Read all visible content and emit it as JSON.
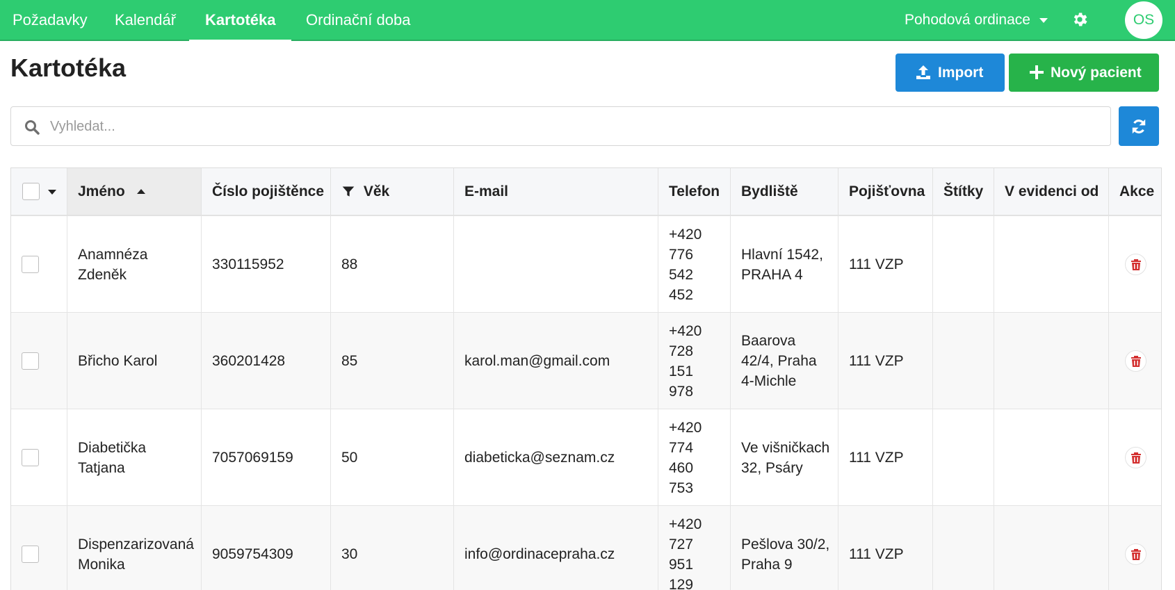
{
  "nav": {
    "items": [
      {
        "label": "Požadavky"
      },
      {
        "label": "Kalendář"
      },
      {
        "label": "Kartotéka"
      },
      {
        "label": "Ordinační doba"
      }
    ],
    "practice": "Pohodová ordinace",
    "avatar": "OS"
  },
  "header": {
    "title": "Kartotéka",
    "import_label": "Import",
    "new_label": "Nový pacient"
  },
  "search": {
    "placeholder": "Vyhledat..."
  },
  "table": {
    "columns": [
      "Jméno",
      "Číslo pojištěnce",
      "Věk",
      "E-mail",
      "Telefon",
      "Bydliště",
      "Pojišťovna",
      "Štítky",
      "V evidenci od",
      "Akce"
    ],
    "rows": [
      {
        "name": [
          "Anamnéza",
          "Zdeněk"
        ],
        "insurance_no": "330115952",
        "age": "88",
        "email": "",
        "phone": [
          "+420",
          "776",
          "542",
          "452"
        ],
        "address": [
          "Hlavní 1542,",
          "PRAHA 4"
        ],
        "insurer": "111 VZP",
        "tags": "",
        "since": ""
      },
      {
        "name": [
          "Břicho Karol"
        ],
        "insurance_no": "360201428",
        "age": "85",
        "email": "karol.man@gmail.com",
        "phone": [
          "+420",
          "728",
          "151",
          "978"
        ],
        "address": [
          "Baarova",
          "42/4, Praha",
          "4-Michle"
        ],
        "insurer": "111 VZP",
        "tags": "",
        "since": ""
      },
      {
        "name": [
          "Diabetička",
          "Tatjana"
        ],
        "insurance_no": "7057069159",
        "age": "50",
        "email": "diabeticka@seznam.cz",
        "phone": [
          "+420",
          "774",
          "460",
          "753"
        ],
        "address": [
          "Ve višničkach",
          "32, Psáry"
        ],
        "insurer": "111 VZP",
        "tags": "",
        "since": ""
      },
      {
        "name": [
          "Dispenzarizovaná",
          "Monika"
        ],
        "insurance_no": "9059754309",
        "age": "30",
        "email": "info@ordinacepraha.cz",
        "phone": [
          "+420",
          "727",
          "951",
          "129"
        ],
        "address": [
          "Pešlova 30/2,",
          "Praha 9"
        ],
        "insurer": "111 VZP",
        "tags": "",
        "since": ""
      }
    ]
  },
  "colors": {
    "nav_bg": "#2ecc71",
    "import_btn": "#1e88d8",
    "new_btn": "#27b34a",
    "delete_icon": "#d32f2f"
  },
  "icons": {
    "settings": "gear-icon",
    "import": "upload-icon",
    "new": "plus-icon",
    "search": "search-icon",
    "refresh": "refresh-icon",
    "sort": "sort-asc-icon",
    "filter": "filter-icon",
    "delete": "trash-icon"
  }
}
